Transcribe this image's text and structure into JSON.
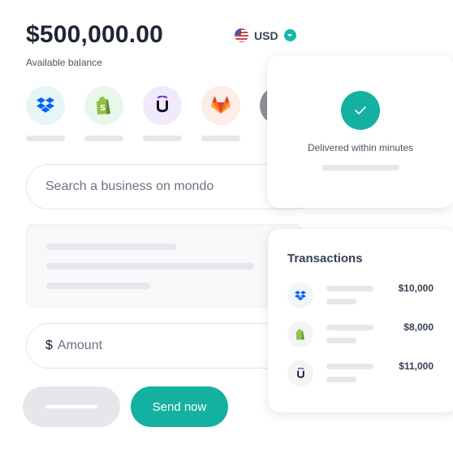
{
  "balance": {
    "amount": "$500,000.00",
    "label": "Available balance"
  },
  "currency": {
    "code": "USD",
    "flag_icon": "us-flag-icon",
    "accent": "#14b8a6"
  },
  "businesses": [
    {
      "name": "dropbox",
      "icon": "dropbox-icon",
      "bg": "#e6f6f7",
      "color": "#0061fe"
    },
    {
      "name": "shopify",
      "icon": "shopify-icon",
      "bg": "#e9f7ea",
      "color": "#95bf47"
    },
    {
      "name": "upwork",
      "icon": "upwork-icon",
      "bg": "#f1eafc",
      "color": "#6c2bd9"
    },
    {
      "name": "gitlab",
      "icon": "gitlab-icon",
      "bg": "#fdece8",
      "color": "#e24329"
    }
  ],
  "search": {
    "placeholder": "Search a business on mondo"
  },
  "amount": {
    "currency_symbol": "$",
    "placeholder": "Amount"
  },
  "actions": {
    "send_label": "Send now",
    "primary_color": "#14b1a0"
  },
  "delivered": {
    "text": "Delivered within minutes"
  },
  "transactions": {
    "title": "Transactions",
    "items": [
      {
        "icon": "dropbox-icon",
        "amount": "$10,000"
      },
      {
        "icon": "shopify-icon",
        "amount": "$8,000"
      },
      {
        "icon": "upwork-icon",
        "amount": "$11,000"
      }
    ]
  }
}
